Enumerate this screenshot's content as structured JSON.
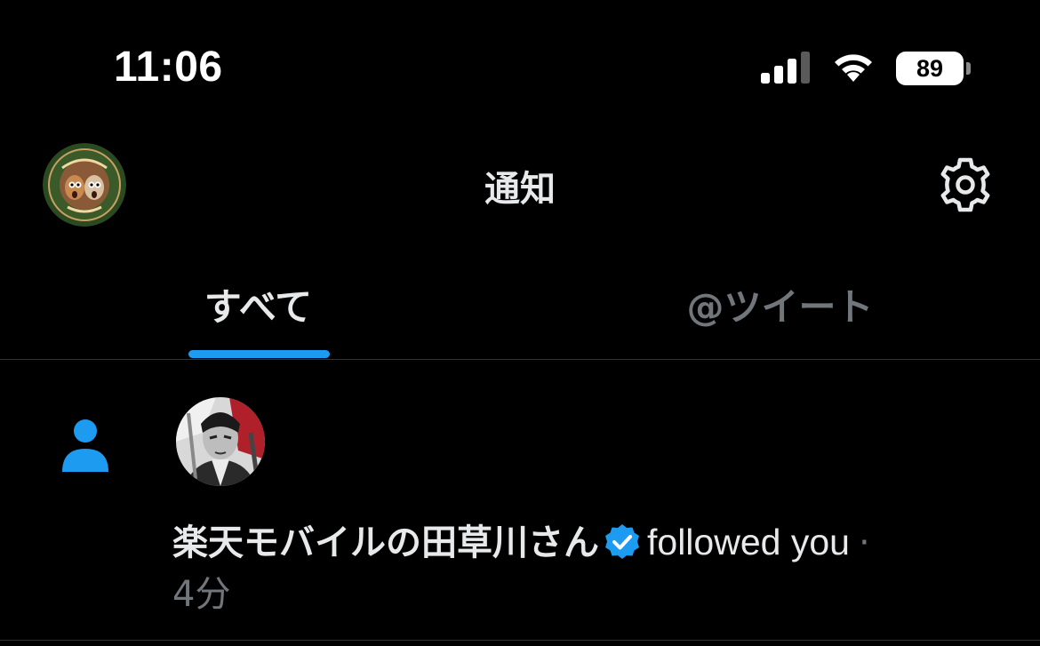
{
  "status_bar": {
    "time": "11:06",
    "battery_level": "89",
    "icons": [
      "cellular-signal-icon",
      "wifi-icon",
      "battery-icon"
    ]
  },
  "header": {
    "title": "通知",
    "avatar_icon": "profile-avatar",
    "settings_icon": "gear-icon"
  },
  "tabs": [
    {
      "label": "すべて",
      "selected": true
    },
    {
      "label": "@ツイート",
      "selected": false
    }
  ],
  "notifications": [
    {
      "type_icon": "person-icon",
      "user_name": "楽天モバイルの田草川さん",
      "verified": true,
      "action": "followed you",
      "separator": "·",
      "time_ago": "4分"
    }
  ],
  "colors": {
    "background": "#000000",
    "text_primary": "#e7e9ea",
    "text_secondary": "#71767b",
    "accent": "#1d9bf0",
    "divider": "#2f3336"
  }
}
